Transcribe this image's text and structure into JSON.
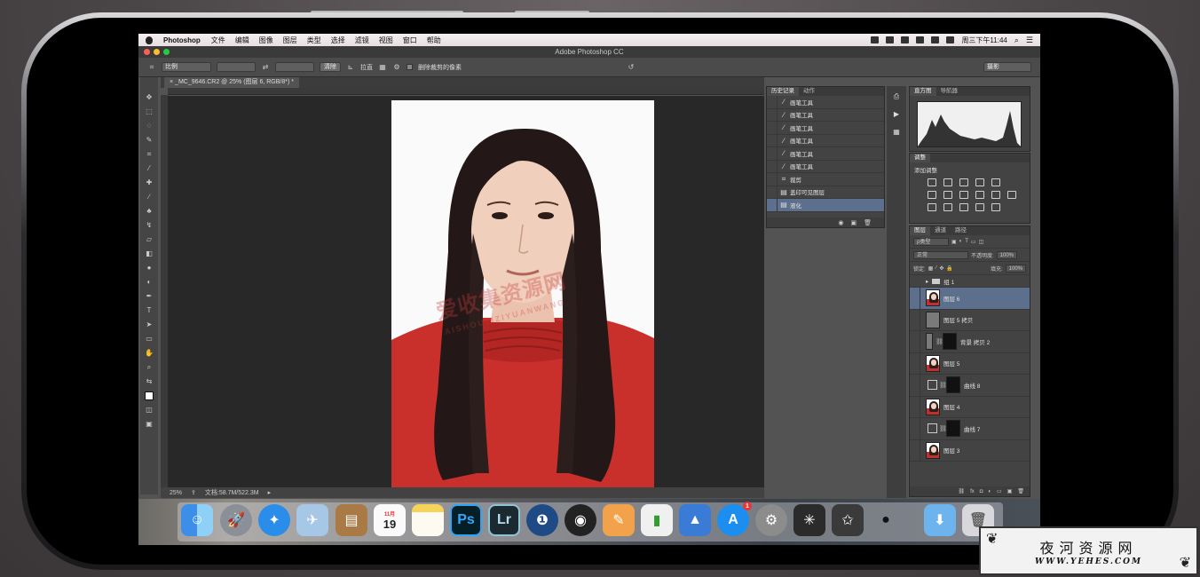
{
  "menubar": {
    "app_name": "Photoshop",
    "items": [
      "文件",
      "编辑",
      "图像",
      "图层",
      "类型",
      "选择",
      "滤镜",
      "视图",
      "窗口",
      "帮助"
    ],
    "clock": "周三下午11:44"
  },
  "window": {
    "title": "Adobe Photoshop CC"
  },
  "options": {
    "ratio_label": "比例",
    "clear_label": "清除",
    "straighten_label": "拉直",
    "delete_cropped_label": "删除裁剪的像素",
    "workspace_label": "摄影"
  },
  "document": {
    "tab_title": "_MC_9646.CR2 @ 25% (图层 6, RGB/8*) *",
    "zoom": "25%",
    "doc_size": "文档:58.7M/522.3M"
  },
  "canvas_watermark": {
    "text": "爱收集资源网",
    "sub": "AISHOUJIZIYUANWANG"
  },
  "history": {
    "tabs": [
      "历史记录",
      "动作"
    ],
    "items": [
      {
        "label": "画笔工具",
        "icon": "brush-icon"
      },
      {
        "label": "画笔工具",
        "icon": "brush-icon"
      },
      {
        "label": "画笔工具",
        "icon": "brush-icon"
      },
      {
        "label": "画笔工具",
        "icon": "brush-icon"
      },
      {
        "label": "画笔工具",
        "icon": "brush-icon"
      },
      {
        "label": "画笔工具",
        "icon": "brush-icon"
      },
      {
        "label": "裁剪",
        "icon": "crop-icon"
      },
      {
        "label": "盖印可见图层",
        "icon": "document-icon"
      },
      {
        "label": "液化",
        "icon": "document-icon",
        "selected": true
      }
    ]
  },
  "histogram_panel": {
    "tabs": [
      "直方图",
      "导航器"
    ]
  },
  "adjustments": {
    "tab": "调整",
    "title": "添加调整"
  },
  "layers": {
    "tabs": [
      "图层",
      "通道",
      "路径"
    ],
    "kind_label": "ρ类型",
    "blend_mode": "正常",
    "opacity_label": "不透明度:",
    "opacity_value": "100%",
    "lock_label": "锁定:",
    "fill_label": "填充:",
    "fill_value": "100%",
    "group_name": "组 1",
    "rows": [
      {
        "name": "图层 6",
        "type": "photo",
        "selected": true
      },
      {
        "name": "图层 5 拷贝",
        "type": "gray"
      },
      {
        "name": "背景 拷贝 2",
        "type": "mask"
      },
      {
        "name": "图层 5",
        "type": "photo"
      },
      {
        "name": "曲线 8",
        "type": "adjust"
      },
      {
        "name": "图层 4",
        "type": "photo"
      },
      {
        "name": "曲线 7",
        "type": "adjust"
      },
      {
        "name": "图层 3",
        "type": "photo"
      }
    ]
  },
  "dock": {
    "calendar_month": "11月",
    "calendar_day": "19",
    "ps_label": "Ps",
    "lr_label": "Lr",
    "appstore_badge": "1"
  },
  "corner_watermark": {
    "cn": "夜河资源网",
    "en": "WWW.YEHES.COM"
  },
  "colors": {
    "ps_accent": "#5c6f8d",
    "traffic_close": "#fc5f57",
    "traffic_min": "#fdbb2e",
    "traffic_max": "#28c840",
    "shirt_red": "#c9302c"
  }
}
